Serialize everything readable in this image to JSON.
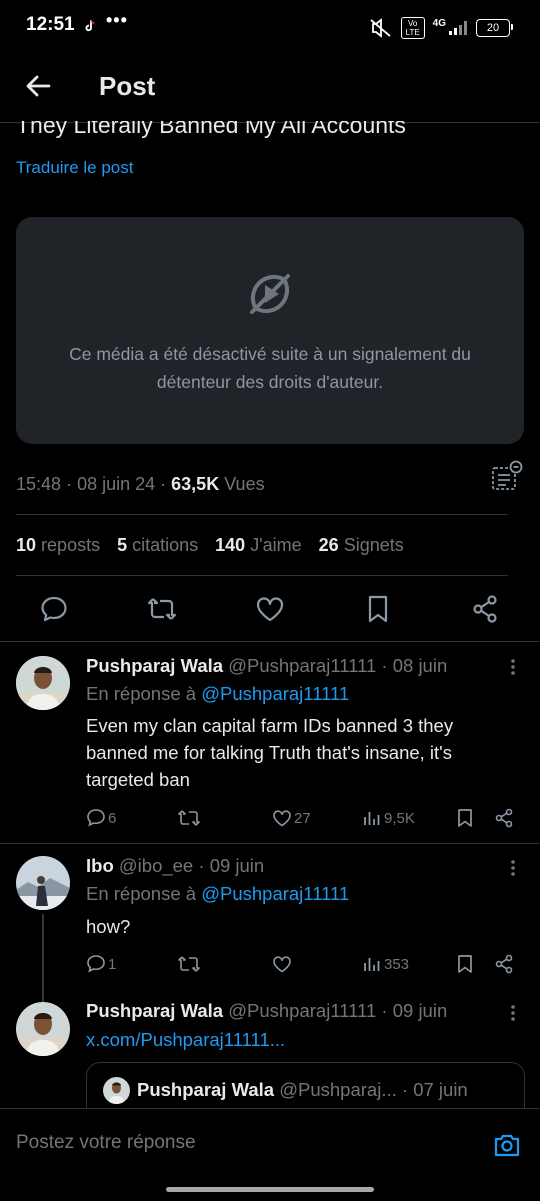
{
  "status_bar": {
    "time": "12:51",
    "dots": "•••",
    "network": "4G",
    "volte": "Vo LTE",
    "battery": "20"
  },
  "header": {
    "title": "Post"
  },
  "post": {
    "text": "They Literally Banned My All Accounts",
    "translate": "Traduire le post",
    "media_notice": "Ce média a été désactivé suite à un signalement du détenteur des droits d'auteur.",
    "time": "15:48",
    "date": "08 juin 24",
    "views_count": "63,5K",
    "views_label": "Vues",
    "reposts_count": "10",
    "reposts_label": "reposts",
    "quotes_count": "5",
    "quotes_label": "citations",
    "likes_count": "140",
    "likes_label": "J'aime",
    "bookmarks_count": "26",
    "bookmarks_label": "Signets"
  },
  "replies": [
    {
      "name": "Pushparaj Wala",
      "handle": "@Pushparaj11111",
      "date": "08 juin",
      "reply_prefix": "En réponse à",
      "reply_to": "@Pushparaj11111",
      "body": "Even my clan capital farm IDs banned 3 they banned me for talking Truth that's insane, it's targeted ban",
      "replies": "6",
      "likes": "27",
      "views": "9,5K"
    },
    {
      "name": "Ibo",
      "handle": "@ibo_ee",
      "date": "09 juin",
      "reply_prefix": "En réponse à",
      "reply_to": "@Pushparaj11111",
      "body": "how?",
      "replies": "1",
      "likes": "",
      "views": "353"
    },
    {
      "name": "Pushparaj Wala",
      "handle": "@Pushparaj11111",
      "date": "09 juin",
      "link": "x.com/Pushparaj11111...",
      "quote_name": "Pushparaj Wala",
      "quote_handle": "@Pushparaj...",
      "quote_date": "07 juin"
    }
  ],
  "compose": {
    "placeholder": "Postez votre réponse"
  },
  "colors": {
    "accent": "#1d9bf0",
    "muted": "#71767b",
    "text": "#e7e9ea",
    "background": "#000000"
  }
}
